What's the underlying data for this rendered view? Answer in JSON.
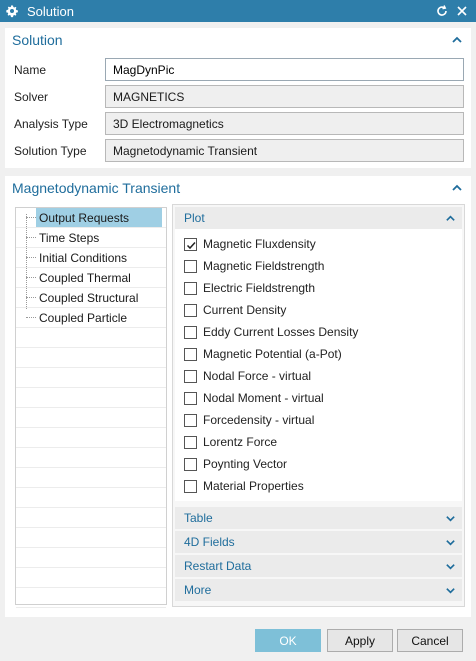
{
  "window": {
    "title": "Solution"
  },
  "solution": {
    "header": "Solution",
    "name_label": "Name",
    "name_value": "MagDynPic",
    "solver_label": "Solver",
    "solver_value": "MAGNETICS",
    "analysis_label": "Analysis Type",
    "analysis_value": "3D Electromagnetics",
    "soltype_label": "Solution Type",
    "soltype_value": "Magnetodynamic Transient"
  },
  "transient": {
    "header": "Magnetodynamic Transient",
    "tree": [
      {
        "label": "Output Requests",
        "selected": true
      },
      {
        "label": "Time Steps"
      },
      {
        "label": "Initial Conditions"
      },
      {
        "label": "Coupled Thermal"
      },
      {
        "label": "Coupled Structural"
      },
      {
        "label": "Coupled Particle"
      }
    ],
    "plot_header": "Plot",
    "plot_items": [
      {
        "label": "Magnetic Fluxdensity",
        "checked": true
      },
      {
        "label": "Magnetic Fieldstrength",
        "checked": false
      },
      {
        "label": "Electric Fieldstrength",
        "checked": false
      },
      {
        "label": "Current Density",
        "checked": false
      },
      {
        "label": "Eddy Current Losses Density",
        "checked": false
      },
      {
        "label": "Magnetic Potential (a-Pot)",
        "checked": false
      },
      {
        "label": "Nodal Force - virtual",
        "checked": false
      },
      {
        "label": "Nodal Moment - virtual",
        "checked": false
      },
      {
        "label": "Forcedensity - virtual",
        "checked": false
      },
      {
        "label": "Lorentz Force",
        "checked": false
      },
      {
        "label": "Poynting Vector",
        "checked": false
      },
      {
        "label": "Material Properties",
        "checked": false
      }
    ],
    "collapsed_sections": [
      "Table",
      "4D Fields",
      "Restart Data",
      "More"
    ]
  },
  "buttons": {
    "ok": "OK",
    "apply": "Apply",
    "cancel": "Cancel"
  },
  "icons": {
    "title_gear": "gear-icon",
    "reset": "reset-icon",
    "close": "close-icon",
    "collapse": "chevron-up-icon",
    "expand": "chevron-down-icon",
    "check": "checkmark-icon"
  },
  "colors": {
    "titlebar": "#2e7eaa",
    "header_text": "#1f6d9c",
    "selection": "#9fcfe4",
    "ok_button": "#7ec0d8"
  }
}
